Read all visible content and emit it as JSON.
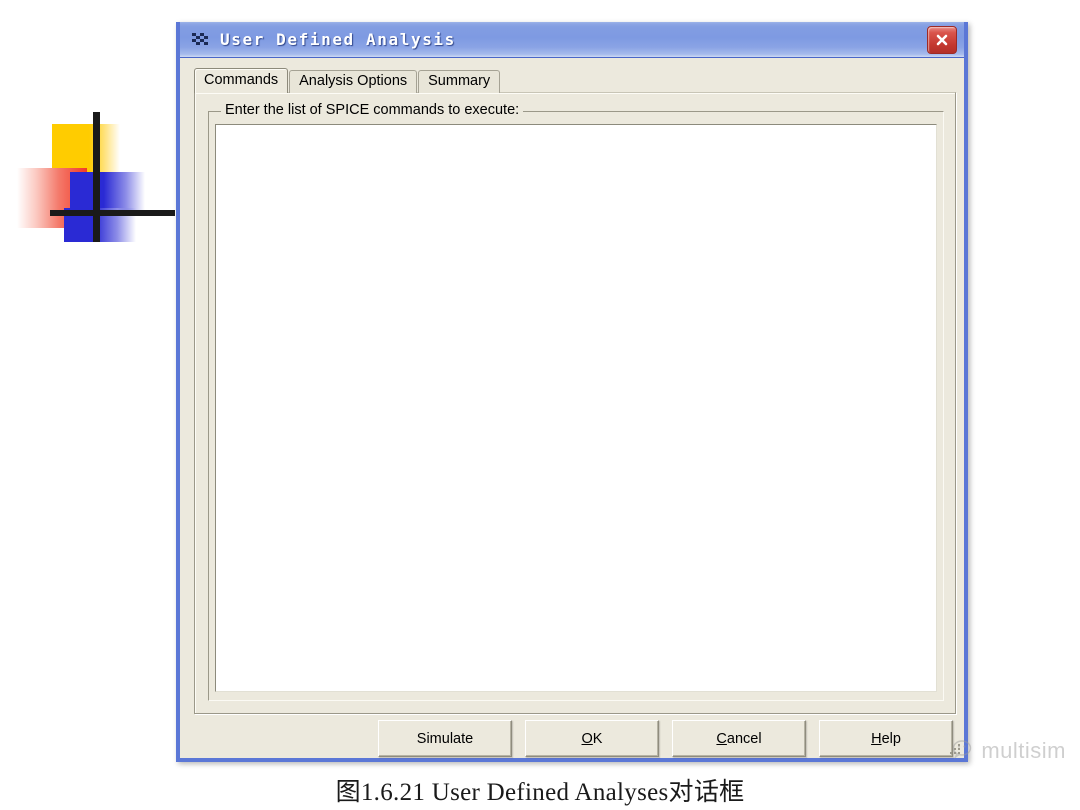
{
  "colors": {
    "title_gradient_start": "#9cb3e8",
    "title_gradient_end": "#cdd9f4",
    "dialog_border": "#5b77d6",
    "dialog_face": "#ece9dd",
    "close_button": "#c3372f",
    "text_area": "#ffffff",
    "deco_yellow": "#ffcc00",
    "deco_red": "#f13a28",
    "deco_blue": "#2a2ad4",
    "caption_text": "#1a1a1a",
    "watermark_text": "#9c9c9c"
  },
  "dialog": {
    "title": "User Defined Analysis",
    "title_icon": "checkered-flag-icon",
    "close_icon": "close-icon",
    "close_label": "Close",
    "tabs": [
      {
        "label": "Commands",
        "active": true
      },
      {
        "label": "Analysis Options",
        "active": false
      },
      {
        "label": "Summary",
        "active": false
      }
    ],
    "commands_tab": {
      "group_label": "Enter the list of SPICE commands to execute:",
      "textarea_value": "",
      "textarea_placeholder": ""
    },
    "buttons": [
      {
        "id": "simulate",
        "label": "Simulate",
        "accel": ""
      },
      {
        "id": "ok",
        "label": "OK",
        "accel": "O"
      },
      {
        "id": "cancel",
        "label": "Cancel",
        "accel": "C"
      },
      {
        "id": "help",
        "label": "Help",
        "accel": "H"
      }
    ],
    "resize_grip": "resize-grip"
  },
  "page": {
    "caption": "图1.6.21 User Defined Analyses对话框"
  },
  "watermark": {
    "icon": "wechat-icon",
    "text": "multisim"
  }
}
